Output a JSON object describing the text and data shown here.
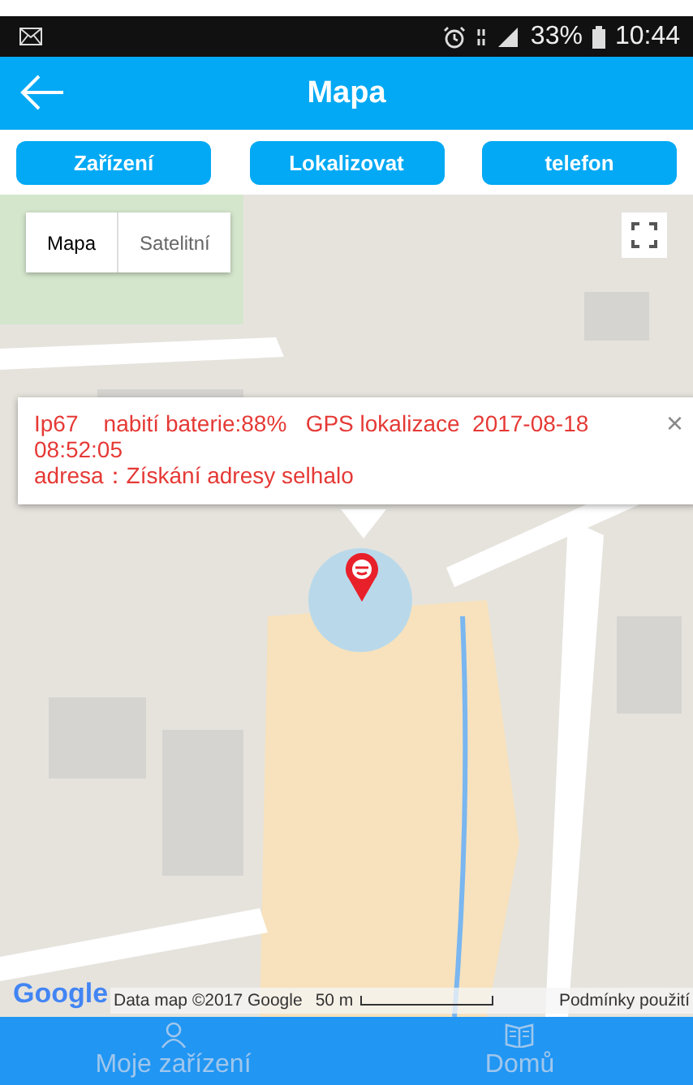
{
  "status_bar": {
    "battery": "33%",
    "time": "10:44"
  },
  "app_bar": {
    "title": "Mapa"
  },
  "actions": [
    "Zařízení",
    "Lokalizovat",
    "telefon"
  ],
  "map": {
    "type_toggle": [
      {
        "label": "Mapa",
        "selected": true
      },
      {
        "label": "Satelitní",
        "selected": false
      }
    ],
    "info_window": {
      "lines": [
        "Ip67    nabití baterie:88%   GPS lokalizace  2017-08-18 08:52:05",
        "adresa：Získání adresy selhalo"
      ],
      "close": "×"
    },
    "logo": "Google",
    "attribution": "Data map ©2017 Google",
    "scale": "50 m",
    "terms": "Podmínky použití"
  },
  "bottom_nav": [
    {
      "label": "Moje zařízení"
    },
    {
      "label": "Domů"
    }
  ]
}
